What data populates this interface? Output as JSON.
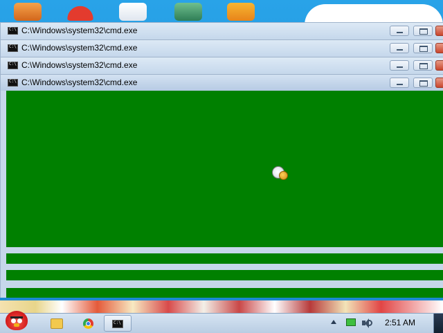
{
  "windows": [
    {
      "title": "C:\\Windows\\system32\\cmd.exe"
    },
    {
      "title": "C:\\Windows\\system32\\cmd.exe"
    },
    {
      "title": "C:\\Windows\\system32\\cmd.exe"
    },
    {
      "title": "C:\\Windows\\system32\\cmd.exe"
    }
  ],
  "colors": {
    "console_background": "#008000",
    "titlebar": "#c6d8ec",
    "desktop": "#1b8fd8"
  },
  "icons": {
    "taskbar_pinned": [
      "angry-birds-start-icon",
      "folder-icon",
      "chrome-icon",
      "cmd-icon"
    ],
    "tray": [
      "show-hidden-icons-arrow",
      "network-icon",
      "volume-icon"
    ]
  },
  "taskbar": {
    "clock": "2:51 AM"
  }
}
